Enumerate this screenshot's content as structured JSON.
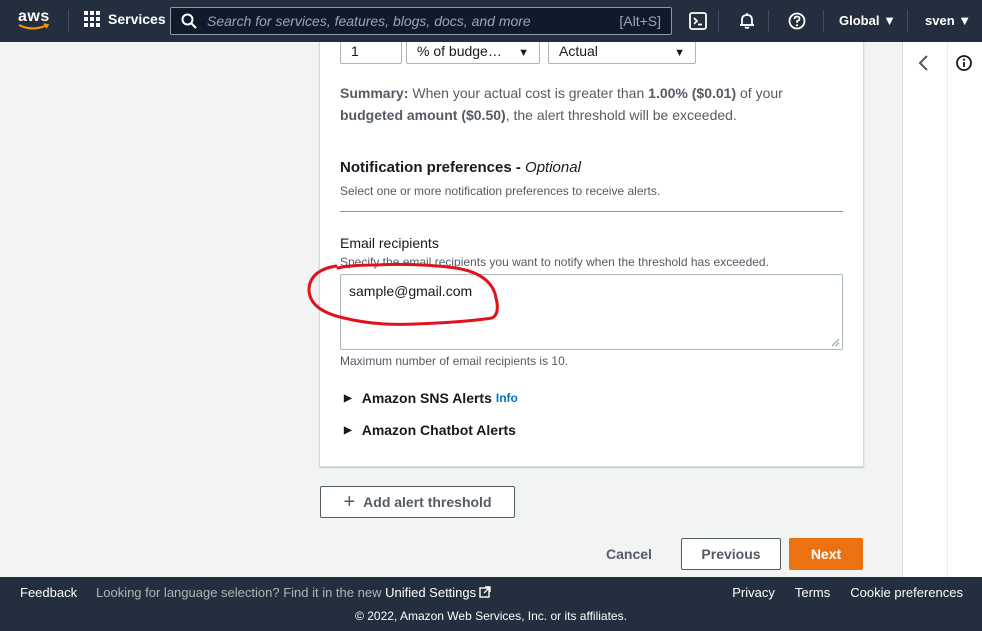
{
  "nav": {
    "logo_text": "aws",
    "services_label": "Services",
    "search_placeholder": "Search for services, features, blogs, docs, and more",
    "search_shortcut": "[Alt+S]",
    "region_label": "Global",
    "user_label": "sven"
  },
  "threshold": {
    "amount_value": "1",
    "unit_select": "% of budge…",
    "type_select": "Actual"
  },
  "summary": {
    "label": "Summary:",
    "text1": " When your actual cost is greater than ",
    "pct": "1.00% ($0.01)",
    "text2": " of your ",
    "budgeted": "budgeted amount ($0.50)",
    "text3": ", the alert threshold will be exceeded."
  },
  "notification": {
    "title": "Notification preferences - ",
    "optional": "Optional",
    "subtitle": "Select one or more notification preferences to receive alerts."
  },
  "email": {
    "label": "Email recipients",
    "description": "Specify the email recipients you want to notify when the threshold has exceeded.",
    "value": "sample@gmail.com",
    "hint": "Maximum number of email recipients is 10."
  },
  "expanders": {
    "sns_label": "Amazon SNS Alerts",
    "sns_info": "Info",
    "chatbot_label": "Amazon Chatbot Alerts"
  },
  "actions": {
    "add_threshold": "Add alert threshold",
    "cancel": "Cancel",
    "previous": "Previous",
    "next": "Next"
  },
  "footer": {
    "feedback": "Feedback",
    "lang_text": "Looking for language selection? Find it in the new ",
    "unified_settings": "Unified Settings",
    "privacy": "Privacy",
    "terms": "Terms",
    "cookie": "Cookie preferences",
    "copyright": "© 2022, Amazon Web Services, Inc. or its affiliates."
  },
  "colors": {
    "nav_bg": "#232f3e",
    "primary_button": "#ec7211",
    "link": "#0073bb",
    "annotation": "#e0131d"
  },
  "icons": [
    "grid-icon",
    "search-icon",
    "cloudshell-icon",
    "bell-icon",
    "help-icon",
    "chevron-left-icon",
    "info-icon",
    "external-link-icon",
    "plus-icon",
    "caret-right-icon"
  ]
}
